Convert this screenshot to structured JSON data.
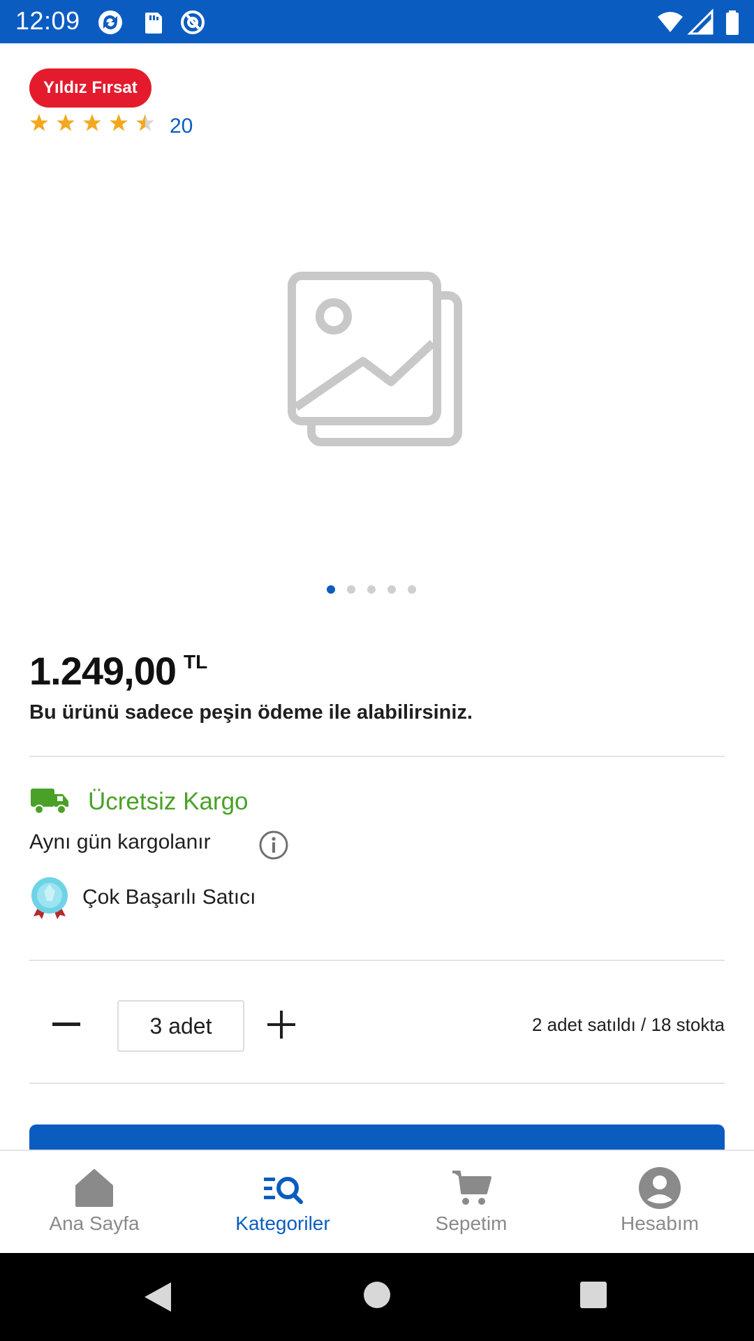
{
  "status_bar": {
    "time": "12:09"
  },
  "product": {
    "badge": "Yıldız Fırsat",
    "rating": {
      "value": 4.5,
      "max": 5,
      "count": "20"
    },
    "image_pager": {
      "pages": 5,
      "active": 1
    },
    "price": "1.249,00",
    "currency": "TL",
    "cash_note": "Bu ürünü sadece peşin ödeme ile alabilirsiniz."
  },
  "shipping": {
    "free_shipping": "Ücretsiz Kargo",
    "same_day": "Aynı gün kargolanır",
    "seller": "Çok Başarılı Satıcı"
  },
  "quantity": {
    "value": "3 adet",
    "stock_info": "2 adet satıldı / 18 stokta"
  },
  "bottom_nav": {
    "items": [
      {
        "label": "Ana Sayfa",
        "icon": "home-icon"
      },
      {
        "label": "Kategoriler",
        "icon": "categories-search-icon",
        "active": true
      },
      {
        "label": "Sepetim",
        "icon": "cart-icon"
      },
      {
        "label": "Hesabım",
        "icon": "account-icon"
      }
    ]
  },
  "colors": {
    "primary": "#0b5cc1",
    "badge": "#e31b2d",
    "success": "#4aa127",
    "star": "#f2a81d"
  }
}
